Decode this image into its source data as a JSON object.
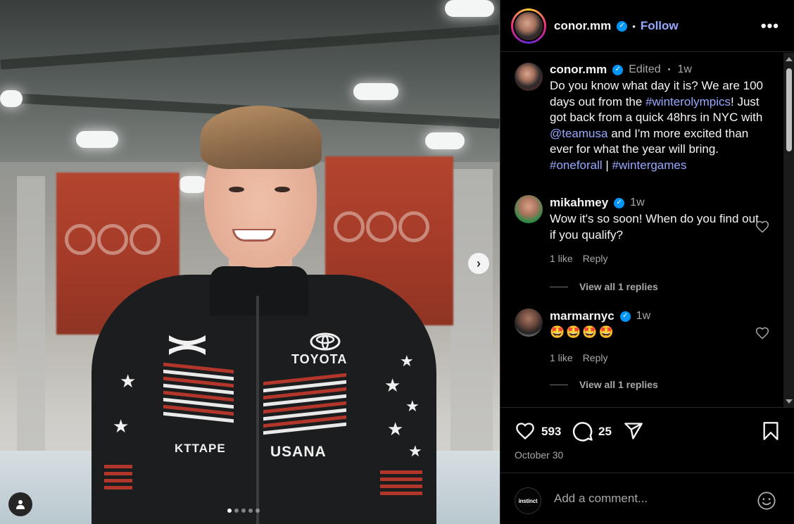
{
  "post": {
    "author": "conor.mm",
    "follow_label": "Follow",
    "separator": "•",
    "more_label": "•••",
    "carousel": {
      "slide_count": 5,
      "current_slide": 1
    },
    "caption": {
      "author": "conor.mm",
      "edited_label": "Edited",
      "time": "1w",
      "text_1": "Do you know what day it is?  We are 100 days out from the ",
      "hashtag_1": "#winterolympics",
      "text_2": "! Just got back from a quick 48hrs in NYC with ",
      "mention": "@teamusa",
      "text_3": " and I'm more excited than ever for what the year will bring. ",
      "hashtag_2": "#oneforall",
      "text_4": " | ",
      "hashtag_3": "#wintergames"
    },
    "comments": [
      {
        "username": "mikahmey",
        "time": "1w",
        "text": "Wow it's so soon! When do you find out if you qualify?",
        "likes": "1 like",
        "reply_label": "Reply",
        "view_replies": "View all 1 replies"
      },
      {
        "username": "marmarnyc",
        "time": "1w",
        "text": "🤩🤩🤩🤩",
        "likes": "1 like",
        "reply_label": "Reply",
        "view_replies": "View all 1 replies"
      }
    ],
    "likes_count": "593",
    "comments_count": "25",
    "date": "October 30",
    "add_comment_placeholder": "Add a comment...",
    "commenter_avatar_text": "instinct"
  },
  "photo_text": {
    "sponsor_1": "TOYOTA",
    "sponsor_2": "KTTAPE",
    "sponsor_3": "USANA"
  },
  "colors": {
    "accent_link": "#97a8ff",
    "verified": "#0095f6",
    "background": "#000000",
    "muted_text": "#a8a8a8"
  },
  "icons": [
    "chevron-right-icon",
    "user-tag-icon",
    "more-icon",
    "verified-icon",
    "heart-icon",
    "comment-icon",
    "share-icon",
    "bookmark-icon",
    "emoji-icon"
  ]
}
